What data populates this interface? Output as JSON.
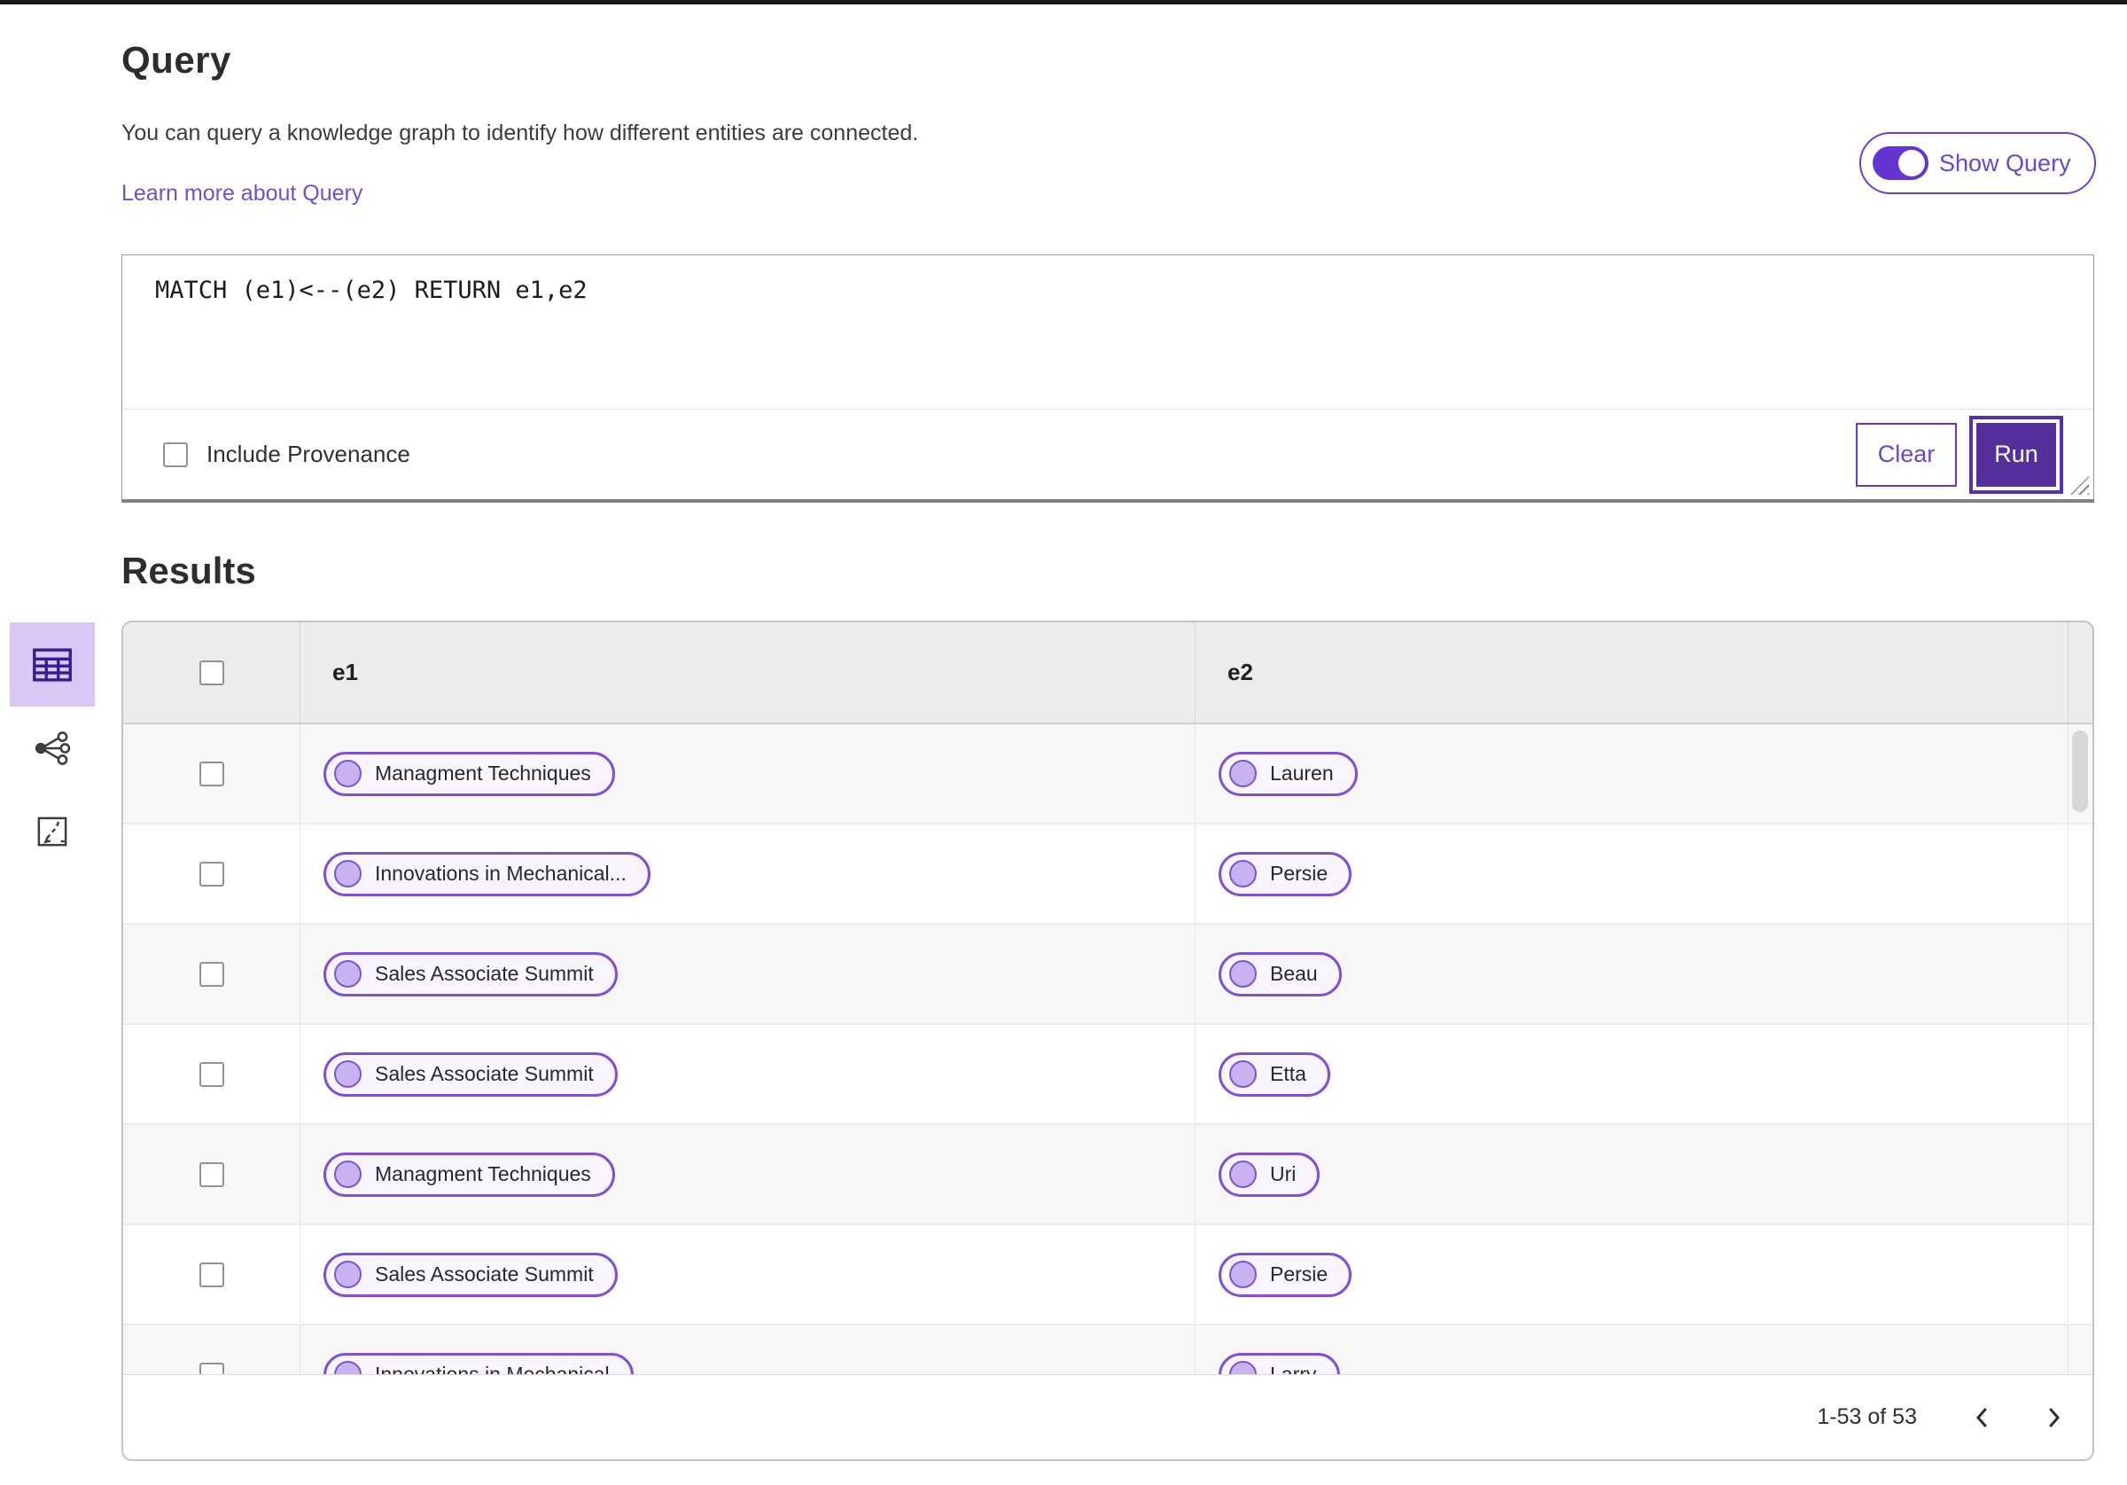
{
  "header": {
    "title": "Query",
    "description": "You can query a knowledge graph to identify how different entities are connected.",
    "learn_more": "Learn more about Query",
    "show_query_label": "Show Query",
    "show_query_on": true
  },
  "query_editor": {
    "query_text": "MATCH (e1)<--(e2) RETURN e1,e2",
    "include_provenance_label": "Include Provenance",
    "include_provenance_checked": false,
    "clear_button": "Clear",
    "run_button": "Run"
  },
  "results": {
    "title": "Results",
    "view_switcher": [
      {
        "name": "table-view",
        "selected": true
      },
      {
        "name": "graph-view",
        "selected": false
      },
      {
        "name": "fit-view",
        "selected": false
      }
    ],
    "table": {
      "select_all_checked": false,
      "columns": [
        "e1",
        "e2"
      ],
      "rows": [
        {
          "e1": "Managment Techniques",
          "e2": "Lauren"
        },
        {
          "e1": "Innovations in Mechanical...",
          "e2": "Persie"
        },
        {
          "e1": "Sales Associate Summit",
          "e2": "Beau"
        },
        {
          "e1": "Sales Associate Summit",
          "e2": "Etta"
        },
        {
          "e1": "Managment Techniques",
          "e2": "Uri"
        },
        {
          "e1": "Sales Associate Summit",
          "e2": "Persie"
        },
        {
          "e1": "Innovations in Mechanical",
          "e2": "Larry"
        }
      ]
    },
    "pagination": {
      "range_label": "1-53 of 53"
    }
  },
  "colors": {
    "accent_purple": "#6334d4",
    "dark_purple_button": "#55309c",
    "link_purple": "#7050d2",
    "selected_view_bg": "#d9c8f6",
    "pill_border": "#7e4fd8",
    "pill_dot_fill": "#c8b2ef",
    "table_header_bg": "#ececec",
    "row_alt_bg": "#f7f7f7"
  }
}
